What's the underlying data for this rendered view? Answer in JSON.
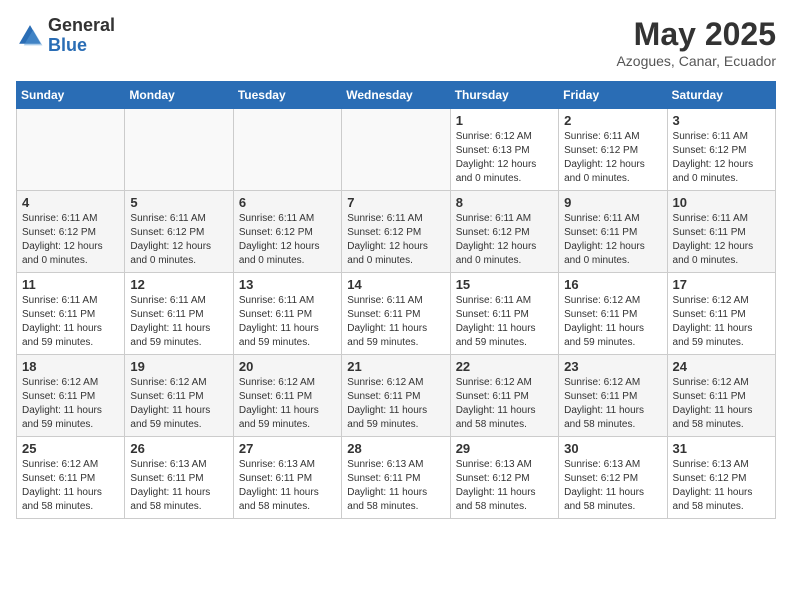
{
  "header": {
    "logo_general": "General",
    "logo_blue": "Blue",
    "month_title": "May 2025",
    "location": "Azogues, Canar, Ecuador"
  },
  "days_of_week": [
    "Sunday",
    "Monday",
    "Tuesday",
    "Wednesday",
    "Thursday",
    "Friday",
    "Saturday"
  ],
  "weeks": [
    [
      {
        "day": "",
        "info": ""
      },
      {
        "day": "",
        "info": ""
      },
      {
        "day": "",
        "info": ""
      },
      {
        "day": "",
        "info": ""
      },
      {
        "day": "1",
        "info": "Sunrise: 6:12 AM\nSunset: 6:13 PM\nDaylight: 12 hours and 0 minutes."
      },
      {
        "day": "2",
        "info": "Sunrise: 6:11 AM\nSunset: 6:12 PM\nDaylight: 12 hours and 0 minutes."
      },
      {
        "day": "3",
        "info": "Sunrise: 6:11 AM\nSunset: 6:12 PM\nDaylight: 12 hours and 0 minutes."
      }
    ],
    [
      {
        "day": "4",
        "info": "Sunrise: 6:11 AM\nSunset: 6:12 PM\nDaylight: 12 hours and 0 minutes."
      },
      {
        "day": "5",
        "info": "Sunrise: 6:11 AM\nSunset: 6:12 PM\nDaylight: 12 hours and 0 minutes."
      },
      {
        "day": "6",
        "info": "Sunrise: 6:11 AM\nSunset: 6:12 PM\nDaylight: 12 hours and 0 minutes."
      },
      {
        "day": "7",
        "info": "Sunrise: 6:11 AM\nSunset: 6:12 PM\nDaylight: 12 hours and 0 minutes."
      },
      {
        "day": "8",
        "info": "Sunrise: 6:11 AM\nSunset: 6:12 PM\nDaylight: 12 hours and 0 minutes."
      },
      {
        "day": "9",
        "info": "Sunrise: 6:11 AM\nSunset: 6:11 PM\nDaylight: 12 hours and 0 minutes."
      },
      {
        "day": "10",
        "info": "Sunrise: 6:11 AM\nSunset: 6:11 PM\nDaylight: 12 hours and 0 minutes."
      }
    ],
    [
      {
        "day": "11",
        "info": "Sunrise: 6:11 AM\nSunset: 6:11 PM\nDaylight: 11 hours and 59 minutes."
      },
      {
        "day": "12",
        "info": "Sunrise: 6:11 AM\nSunset: 6:11 PM\nDaylight: 11 hours and 59 minutes."
      },
      {
        "day": "13",
        "info": "Sunrise: 6:11 AM\nSunset: 6:11 PM\nDaylight: 11 hours and 59 minutes."
      },
      {
        "day": "14",
        "info": "Sunrise: 6:11 AM\nSunset: 6:11 PM\nDaylight: 11 hours and 59 minutes."
      },
      {
        "day": "15",
        "info": "Sunrise: 6:11 AM\nSunset: 6:11 PM\nDaylight: 11 hours and 59 minutes."
      },
      {
        "day": "16",
        "info": "Sunrise: 6:12 AM\nSunset: 6:11 PM\nDaylight: 11 hours and 59 minutes."
      },
      {
        "day": "17",
        "info": "Sunrise: 6:12 AM\nSunset: 6:11 PM\nDaylight: 11 hours and 59 minutes."
      }
    ],
    [
      {
        "day": "18",
        "info": "Sunrise: 6:12 AM\nSunset: 6:11 PM\nDaylight: 11 hours and 59 minutes."
      },
      {
        "day": "19",
        "info": "Sunrise: 6:12 AM\nSunset: 6:11 PM\nDaylight: 11 hours and 59 minutes."
      },
      {
        "day": "20",
        "info": "Sunrise: 6:12 AM\nSunset: 6:11 PM\nDaylight: 11 hours and 59 minutes."
      },
      {
        "day": "21",
        "info": "Sunrise: 6:12 AM\nSunset: 6:11 PM\nDaylight: 11 hours and 59 minutes."
      },
      {
        "day": "22",
        "info": "Sunrise: 6:12 AM\nSunset: 6:11 PM\nDaylight: 11 hours and 58 minutes."
      },
      {
        "day": "23",
        "info": "Sunrise: 6:12 AM\nSunset: 6:11 PM\nDaylight: 11 hours and 58 minutes."
      },
      {
        "day": "24",
        "info": "Sunrise: 6:12 AM\nSunset: 6:11 PM\nDaylight: 11 hours and 58 minutes."
      }
    ],
    [
      {
        "day": "25",
        "info": "Sunrise: 6:12 AM\nSunset: 6:11 PM\nDaylight: 11 hours and 58 minutes."
      },
      {
        "day": "26",
        "info": "Sunrise: 6:13 AM\nSunset: 6:11 PM\nDaylight: 11 hours and 58 minutes."
      },
      {
        "day": "27",
        "info": "Sunrise: 6:13 AM\nSunset: 6:11 PM\nDaylight: 11 hours and 58 minutes."
      },
      {
        "day": "28",
        "info": "Sunrise: 6:13 AM\nSunset: 6:11 PM\nDaylight: 11 hours and 58 minutes."
      },
      {
        "day": "29",
        "info": "Sunrise: 6:13 AM\nSunset: 6:12 PM\nDaylight: 11 hours and 58 minutes."
      },
      {
        "day": "30",
        "info": "Sunrise: 6:13 AM\nSunset: 6:12 PM\nDaylight: 11 hours and 58 minutes."
      },
      {
        "day": "31",
        "info": "Sunrise: 6:13 AM\nSunset: 6:12 PM\nDaylight: 11 hours and 58 minutes."
      }
    ]
  ]
}
